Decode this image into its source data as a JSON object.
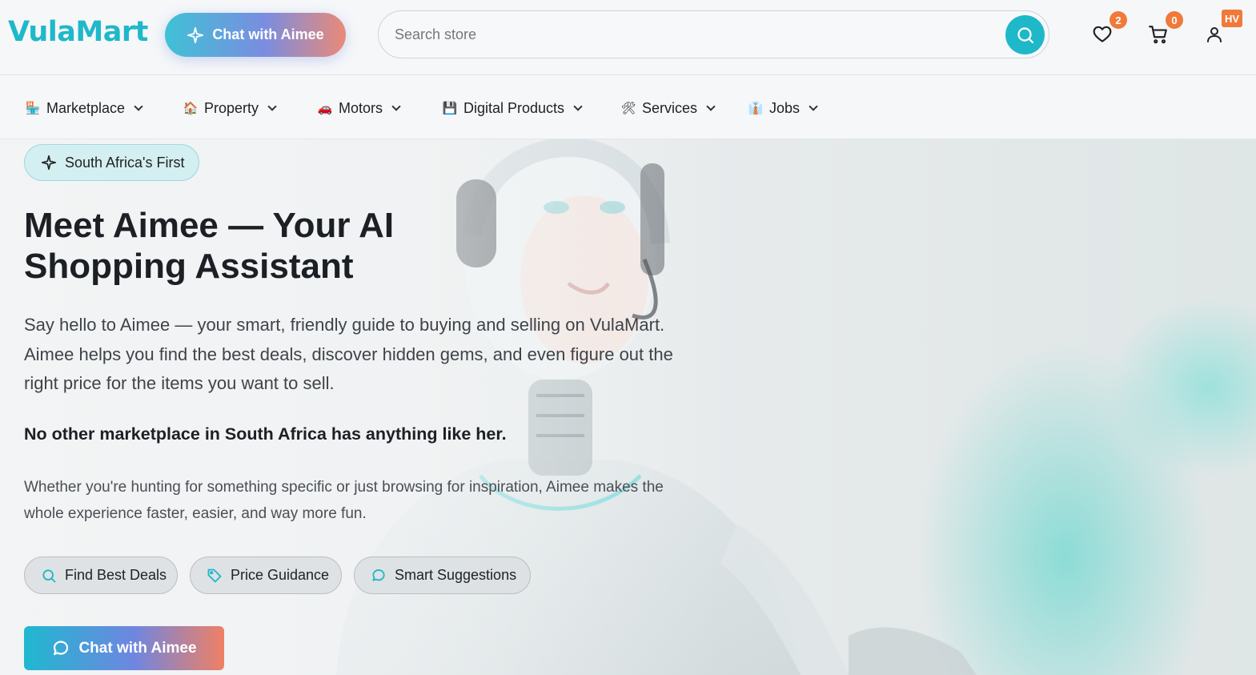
{
  "header": {
    "logo": "VulaMart",
    "chat_button": "Chat with Aimee",
    "search": {
      "placeholder": "Search store",
      "value": ""
    },
    "wishlist_count": "2",
    "cart_count": "0",
    "account_initials": "HV"
  },
  "nav": {
    "items": [
      {
        "emoji": "🏪",
        "label": "Marketplace"
      },
      {
        "emoji": "🏠",
        "label": "Property"
      },
      {
        "emoji": "🚗",
        "label": "Motors"
      },
      {
        "emoji": "💾",
        "label": "Digital Products"
      },
      {
        "emoji": "🛠",
        "label": "Services"
      },
      {
        "emoji": "👔",
        "label": "Jobs"
      }
    ]
  },
  "hero": {
    "badge": "South Africa's First",
    "title": "Meet Aimee — Your AI Shopping Assistant",
    "intro": "Say hello to Aimee — your smart, friendly guide to buying and selling on VulaMart. Aimee helps you find the best deals, discover hidden gems, and even figure out the right price for the items you want to sell.",
    "highlight": "No other marketplace in South Africa has anything like her.",
    "body": "Whether you're hunting for something specific or just browsing for inspiration, Aimee makes the whole experience faster, easier, and way more fun.",
    "features": [
      "Find Best Deals",
      "Price Guidance",
      "Smart Suggestions"
    ],
    "cta": "Chat with Aimee"
  },
  "colors": {
    "brand_teal": "#1fb8c9",
    "badge_orange": "#f07a3a",
    "gradient_pink": "#ef8064",
    "gradient_purple": "#6f86e0"
  },
  "icons": [
    "sparkle-icon",
    "search-icon",
    "heart-icon",
    "cart-icon",
    "user-icon",
    "chevron-down-icon",
    "tag-icon",
    "chat-bubble-icon"
  ]
}
